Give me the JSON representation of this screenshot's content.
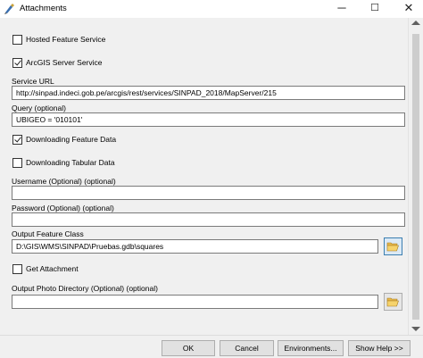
{
  "window": {
    "title": "Attachments",
    "minimize_glyph": "─",
    "maximize_glyph": "☐",
    "close_glyph": "✕"
  },
  "form": {
    "hosted_feature_service": {
      "label": "Hosted Feature Service",
      "checked": false
    },
    "arcgis_server_service": {
      "label": "ArcGIS Server Service",
      "checked": true
    },
    "service_url": {
      "label": "Service URL",
      "value": "http://sinpad.indeci.gob.pe/arcgis/rest/services/SINPAD_2018/MapServer/215"
    },
    "query": {
      "label": "Query (optional)",
      "value": "UBIGEO = '010101'"
    },
    "downloading_feature_data": {
      "label": "Downloading Feature Data",
      "checked": true
    },
    "downloading_tabular_data": {
      "label": "Downloading Tabular Data",
      "checked": false
    },
    "username": {
      "label": "Username (Optional) (optional)",
      "value": ""
    },
    "password": {
      "label": "Password (Optional) (optional)",
      "value": ""
    },
    "output_feature_class": {
      "label": "Output Feature Class",
      "value": "D:\\GIS\\WMS\\SINPAD\\Pruebas.gdb\\squares"
    },
    "get_attachment": {
      "label": "Get Attachment",
      "checked": false
    },
    "output_photo_directory": {
      "label": "Output Photo Directory (Optional) (optional)",
      "value": ""
    }
  },
  "buttons": {
    "ok": "OK",
    "cancel": "Cancel",
    "environments": "Environments...",
    "show_help": "Show Help >>"
  },
  "icons": {
    "app": "toolbox-icon",
    "folder": "folder-open-icon"
  }
}
